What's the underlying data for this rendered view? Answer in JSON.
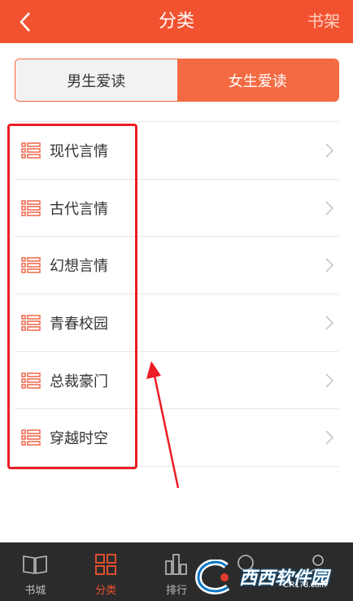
{
  "header": {
    "title": "分类",
    "right_label": "书架"
  },
  "segments": [
    {
      "label": "男生爱读",
      "active": false
    },
    {
      "label": "女生爱读",
      "active": true
    }
  ],
  "categories": [
    {
      "label": "现代言情"
    },
    {
      "label": "古代言情"
    },
    {
      "label": "幻想言情"
    },
    {
      "label": "青春校园"
    },
    {
      "label": "总裁豪门"
    },
    {
      "label": "穿越时空"
    }
  ],
  "tabbar": {
    "items": [
      {
        "label": "书城",
        "icon": "book-icon",
        "active": false
      },
      {
        "label": "分类",
        "icon": "grid-icon",
        "active": true
      },
      {
        "label": "排行",
        "icon": "bars-icon",
        "active": false
      },
      {
        "label": "",
        "icon": "search-icon",
        "active": false
      },
      {
        "label": "",
        "icon": "user-icon",
        "active": false
      }
    ]
  },
  "watermark": {
    "text": "西西软件园",
    "url": "CR173.com"
  },
  "colors": {
    "accent": "#f25230",
    "highlight_box": "#ee1c25",
    "tabbar_bg": "#2b2b2b"
  }
}
